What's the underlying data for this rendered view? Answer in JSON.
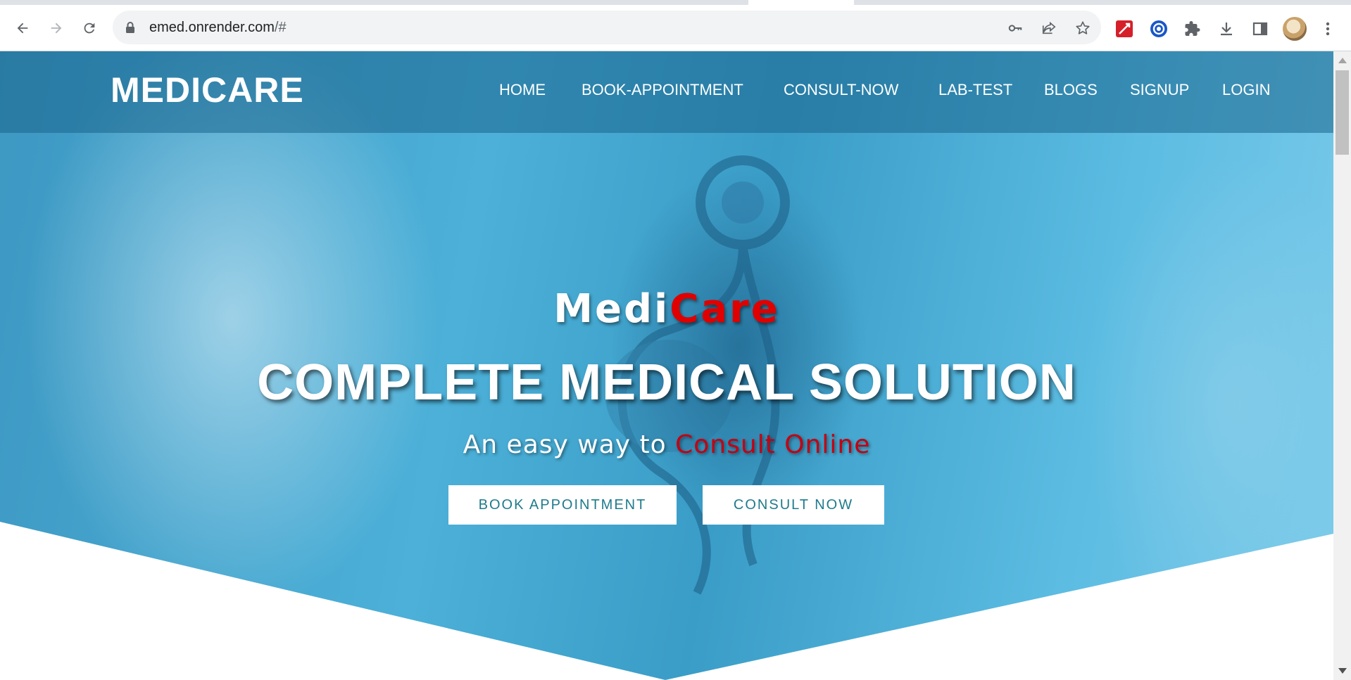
{
  "browser": {
    "url_host": "emed.onrender.com",
    "url_path": "/#",
    "icons": {
      "back": "back-arrow-icon",
      "forward": "forward-arrow-icon",
      "reload": "reload-icon",
      "lock": "lock-icon",
      "key": "key-icon",
      "share": "share-icon",
      "bookmark": "star-icon",
      "extensions": "puzzle-icon",
      "downloads": "download-icon",
      "side_panel": "side-panel-icon",
      "menu": "kebab-menu-icon"
    }
  },
  "site": {
    "logo": "MEDICARE",
    "nav": [
      "HOME",
      "BOOK-APPOINTMENT",
      "CONSULT-NOW",
      "LAB-TEST",
      "BLOGS",
      "SIGNUP",
      "LOGIN"
    ]
  },
  "hero": {
    "brand_part1": "Medi",
    "brand_part2": "Care",
    "headline": "COMPLETE MEDICAL SOLUTION",
    "tagline_part1": "An easy way to",
    "tagline_part2": "Consult Online",
    "buttons": {
      "book": "BOOK APPOINTMENT",
      "consult": "CONSULT NOW"
    }
  },
  "colors": {
    "accent_red": "#e00000",
    "button_text": "#1f7b8c",
    "hero_blue": "#4cb0d8"
  }
}
